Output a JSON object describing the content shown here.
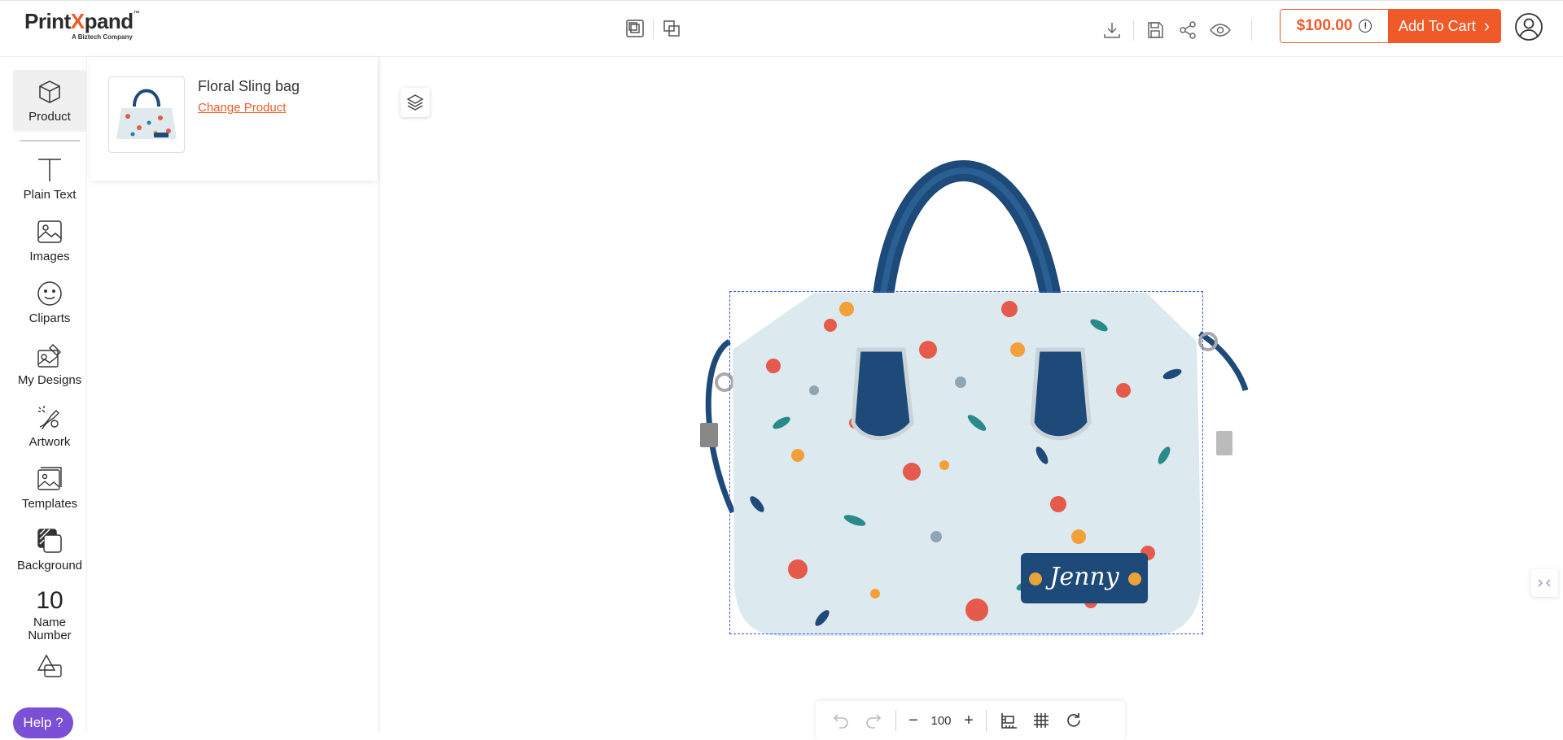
{
  "brand": {
    "name_part1": "Print",
    "name_x": "X",
    "name_part2": "pand",
    "trademark": "™",
    "tagline": "A Biztech Company"
  },
  "header": {
    "price": "$100.00",
    "info_mark": "!",
    "add_to_cart_label": "Add To Cart",
    "cart_chevron": "›"
  },
  "sidebar": {
    "items": [
      {
        "label": "Product",
        "icon": "cube-icon",
        "active": true
      },
      {
        "label": "Plain Text",
        "icon": "text-t-icon"
      },
      {
        "label": "Images",
        "icon": "image-icon"
      },
      {
        "label": "Cliparts",
        "icon": "smiley-icon"
      },
      {
        "label": "My Designs",
        "icon": "my-designs-icon"
      },
      {
        "label": "Artwork",
        "icon": "artwork-icon"
      },
      {
        "label": "Templates",
        "icon": "templates-icon"
      },
      {
        "label": "Background",
        "icon": "background-icon"
      },
      {
        "label": "Name Number",
        "icon": "name-number-icon",
        "number_glyph": "10",
        "line1": "Name",
        "line2": "Number"
      },
      {
        "label": "",
        "icon": "shapes-icon"
      }
    ],
    "help_label": "Help ?"
  },
  "product_panel": {
    "title": "Floral Sling bag",
    "change_link": "Change Product"
  },
  "canvas": {
    "name_tag_text": "Jenny"
  },
  "zoom_bar": {
    "minus": "−",
    "zoom_value": "100",
    "plus": "+"
  },
  "colors": {
    "accent": "#f05a28",
    "help": "#7b4fd6",
    "selection": "#3856e8",
    "bag_navy": "#1d4a78"
  }
}
